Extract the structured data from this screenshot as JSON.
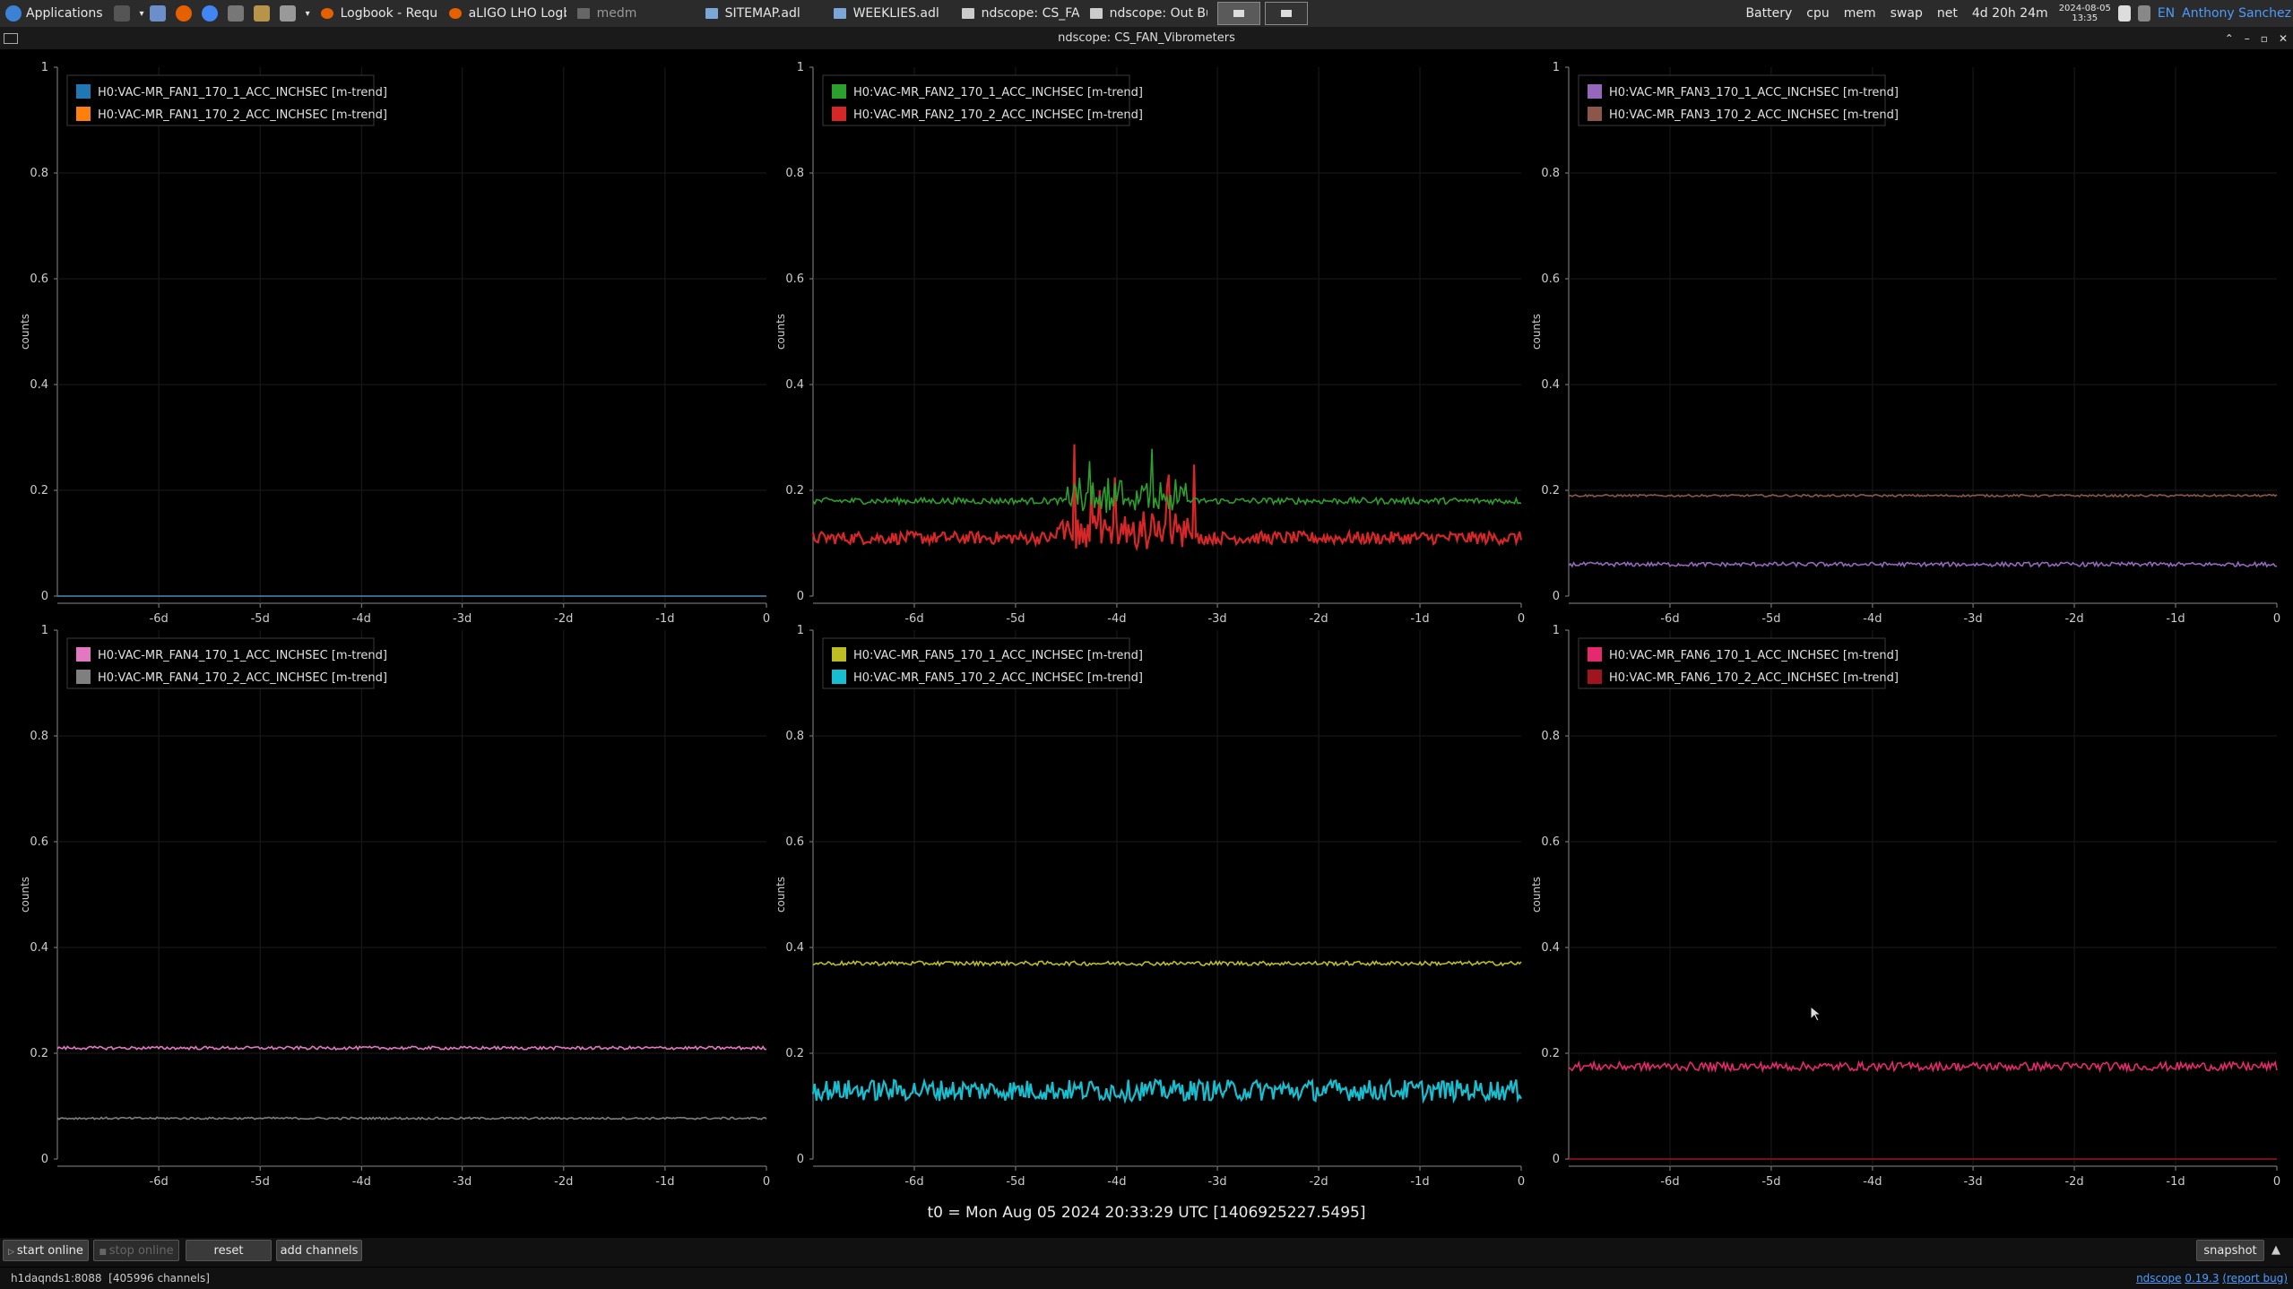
{
  "taskbar": {
    "app_menu": "Applications",
    "tasks": [
      "Logbook - Reque...",
      "aLIGO LHO Logb...",
      "medm",
      "SITEMAP.adl",
      "WEEKLIES.adl",
      "ndscope: CS_FA...",
      "ndscope: Out Bui..."
    ],
    "tray": {
      "battery": "Battery",
      "cpu": "cpu",
      "mem": "mem",
      "swap": "swap",
      "net": "net",
      "uptime": "4d 20h 24m",
      "date": "2024-08-05",
      "time": "13:35",
      "lang": "EN",
      "user": "Anthony Sanchez"
    }
  },
  "window": {
    "title": "ndscope: CS_FAN_Vibrometers"
  },
  "axis": {
    "ylabel": "counts",
    "yticks": [
      "0",
      "0.2",
      "0.4",
      "0.6",
      "0.8",
      "1"
    ],
    "xticks": [
      "-6d",
      "-5d",
      "-4d",
      "-3d",
      "-2d",
      "-1d",
      "0"
    ]
  },
  "plots": [
    {
      "legend": [
        {
          "name": "H0:VAC-MR_FAN1_170_1_ACC_INCHSEC [m-trend]",
          "color": "#1f77b4"
        },
        {
          "name": "H0:VAC-MR_FAN1_170_2_ACC_INCHSEC [m-trend]",
          "color": "#ff7f0e"
        }
      ]
    },
    {
      "legend": [
        {
          "name": "H0:VAC-MR_FAN2_170_1_ACC_INCHSEC [m-trend]",
          "color": "#2ca02c"
        },
        {
          "name": "H0:VAC-MR_FAN2_170_2_ACC_INCHSEC [m-trend]",
          "color": "#d62728"
        }
      ]
    },
    {
      "legend": [
        {
          "name": "H0:VAC-MR_FAN3_170_1_ACC_INCHSEC [m-trend]",
          "color": "#9467bd"
        },
        {
          "name": "H0:VAC-MR_FAN3_170_2_ACC_INCHSEC [m-trend]",
          "color": "#8c564b"
        }
      ]
    },
    {
      "legend": [
        {
          "name": "H0:VAC-MR_FAN4_170_1_ACC_INCHSEC [m-trend]",
          "color": "#e377c2"
        },
        {
          "name": "H0:VAC-MR_FAN4_170_2_ACC_INCHSEC [m-trend]",
          "color": "#7f7f7f"
        }
      ]
    },
    {
      "legend": [
        {
          "name": "H0:VAC-MR_FAN5_170_1_ACC_INCHSEC [m-trend]",
          "color": "#bcbd22"
        },
        {
          "name": "H0:VAC-MR_FAN5_170_2_ACC_INCHSEC [m-trend]",
          "color": "#17becf"
        }
      ]
    },
    {
      "legend": [
        {
          "name": "H0:VAC-MR_FAN6_170_1_ACC_INCHSEC [m-trend]",
          "color": "#e6296e"
        },
        {
          "name": "H0:VAC-MR_FAN6_170_2_ACC_INCHSEC [m-trend]",
          "color": "#a0141e"
        }
      ]
    }
  ],
  "chart_data": [
    {
      "type": "line",
      "ylabel": "counts",
      "ylim": [
        0,
        1
      ],
      "xlim": [
        "-7d",
        "0"
      ],
      "grid": true,
      "legend_position": "top-left",
      "series": [
        {
          "name": "H0:VAC-MR_FAN1_170_1_ACC_INCHSEC [m-trend]",
          "level": 0.0,
          "noise": 0.0
        },
        {
          "name": "H0:VAC-MR_FAN1_170_2_ACC_INCHSEC [m-trend]",
          "level": 0.0,
          "noise": 0.0
        }
      ]
    },
    {
      "type": "line",
      "ylabel": "counts",
      "ylim": [
        0,
        1
      ],
      "xlim": [
        "-7d",
        "0"
      ],
      "grid": true,
      "legend_position": "top-left",
      "series": [
        {
          "name": "H0:VAC-MR_FAN2_170_1_ACC_INCHSEC [m-trend]",
          "level": 0.18,
          "noise": 0.006,
          "burst": [
            -4.5,
            -3.3,
            0.28
          ]
        },
        {
          "name": "H0:VAC-MR_FAN2_170_2_ACC_INCHSEC [m-trend]",
          "level": 0.11,
          "noise": 0.012,
          "burst": [
            -4.6,
            -3.2,
            0.3
          ]
        }
      ]
    },
    {
      "type": "line",
      "ylabel": "counts",
      "ylim": [
        0,
        1
      ],
      "xlim": [
        "-7d",
        "0"
      ],
      "grid": true,
      "legend_position": "top-left",
      "series": [
        {
          "name": "H0:VAC-MR_FAN3_170_1_ACC_INCHSEC [m-trend]",
          "level": 0.06,
          "noise": 0.004
        },
        {
          "name": "H0:VAC-MR_FAN3_170_2_ACC_INCHSEC [m-trend]",
          "level": 0.19,
          "noise": 0.002
        }
      ]
    },
    {
      "type": "line",
      "ylabel": "counts",
      "ylim": [
        0,
        1
      ],
      "xlim": [
        "-7d",
        "0"
      ],
      "grid": true,
      "legend_position": "top-left",
      "series": [
        {
          "name": "H0:VAC-MR_FAN4_170_1_ACC_INCHSEC [m-trend]",
          "level": 0.21,
          "noise": 0.003
        },
        {
          "name": "H0:VAC-MR_FAN4_170_2_ACC_INCHSEC [m-trend]",
          "level": 0.077,
          "noise": 0.002
        }
      ]
    },
    {
      "type": "line",
      "ylabel": "counts",
      "ylim": [
        0,
        1
      ],
      "xlim": [
        "-7d",
        "0"
      ],
      "grid": true,
      "legend_position": "top-left",
      "series": [
        {
          "name": "H0:VAC-MR_FAN5_170_1_ACC_INCHSEC [m-trend]",
          "level": 0.37,
          "noise": 0.004
        },
        {
          "name": "H0:VAC-MR_FAN5_170_2_ACC_INCHSEC [m-trend]",
          "level": 0.13,
          "noise": 0.02
        }
      ]
    },
    {
      "type": "line",
      "ylabel": "counts",
      "ylim": [
        0,
        1
      ],
      "xlim": [
        "-7d",
        "0"
      ],
      "grid": true,
      "legend_position": "top-left",
      "series": [
        {
          "name": "H0:VAC-MR_FAN6_170_1_ACC_INCHSEC [m-trend]",
          "level": 0.175,
          "noise": 0.008
        },
        {
          "name": "H0:VAC-MR_FAN6_170_2_ACC_INCHSEC [m-trend]",
          "level": 0.0,
          "noise": 0.0
        }
      ]
    }
  ],
  "t0": "t0 = Mon Aug 05 2024 20:33:29 UTC [1406925227.5495]",
  "buttons": {
    "start_online": "start online",
    "stop_online": "stop online",
    "reset": "reset",
    "add_channels": "add channels",
    "snapshot": "snapshot"
  },
  "status": {
    "server": "h1daqnds1:8088",
    "channels": "[405996 channels]",
    "app": "ndscope",
    "version": "0.19.3",
    "report": "(report bug)"
  }
}
